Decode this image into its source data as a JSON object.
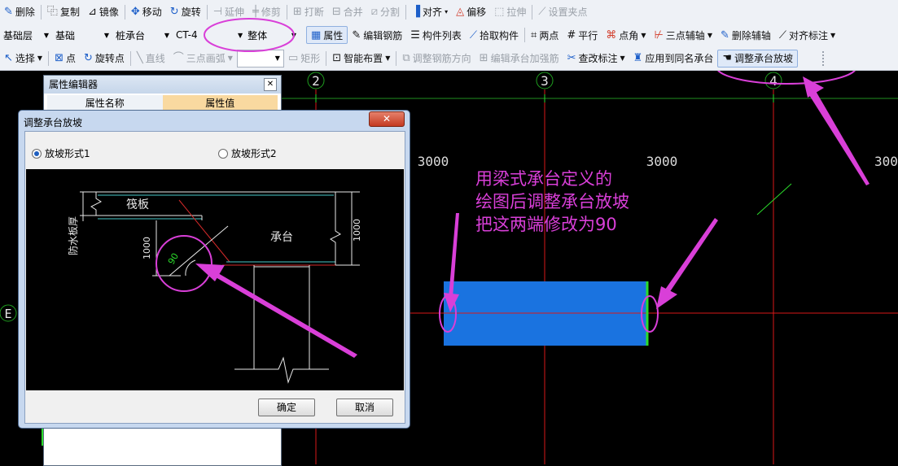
{
  "toolbar1": {
    "delete": "删除",
    "copy": "复制",
    "mirror": "镜像",
    "move": "移动",
    "rotate": "旋转",
    "extend": "延伸",
    "trim": "修剪",
    "break": "打断",
    "merge": "合并",
    "split": "分割",
    "align": "对齐",
    "offset": "偏移",
    "stretch": "拉伸",
    "set_grip": "设置夹点"
  },
  "toolbar2": {
    "layer": "基础层",
    "category": "基础",
    "type": "桩承台",
    "element": "CT-4",
    "mode": "整体",
    "properties": "属性",
    "edit_rebar": "编辑钢筋",
    "member_list": "构件列表",
    "pick_member": "拾取构件",
    "two_points": "两点",
    "parallel": "平行",
    "point_angle": "点角",
    "three_point_aux": "三点辅轴",
    "delete_aux": "删除辅轴",
    "align_dim": "对齐标注"
  },
  "toolbar3": {
    "select": "选择",
    "point": "点",
    "rotate_point": "旋转点",
    "line": "直线",
    "three_point_arc": "三点画弧",
    "rect": "矩形",
    "smart_layout": "智能布置",
    "adjust_rebar_dir": "调整钢筋方向",
    "edit_cap_rebar": "编辑承台加强筋",
    "modify_dim": "查改标注",
    "apply_same_name": "应用到同名承台",
    "adjust_slope": "调整承台放坡"
  },
  "canvas": {
    "axis_labels": [
      "2",
      "3",
      "4",
      "E"
    ],
    "dims": [
      "3000",
      "3000",
      "300"
    ],
    "annotation_lines": [
      "用梁式承台定义的",
      "绘图后调整承台放坡",
      "把这两端修改为90"
    ]
  },
  "property_editor": {
    "title": "属性编辑器",
    "col_name": "属性名称",
    "col_value": "属性值"
  },
  "dialog": {
    "title": "调整承台放坡",
    "option1": "放坡形式1",
    "option2": "放坡形式2",
    "ok": "确定",
    "cancel": "取消",
    "diagram": {
      "raft": "筏板",
      "cap": "承台",
      "waterproof": "防水板厚",
      "h_left": "1000",
      "h_right": "1000",
      "angle": "90"
    }
  },
  "colors": {
    "annotation": "#d93fd8",
    "cap_fill": "#1a73e0",
    "grid_red": "#d81818",
    "edge_green": "#2bdc2b"
  }
}
